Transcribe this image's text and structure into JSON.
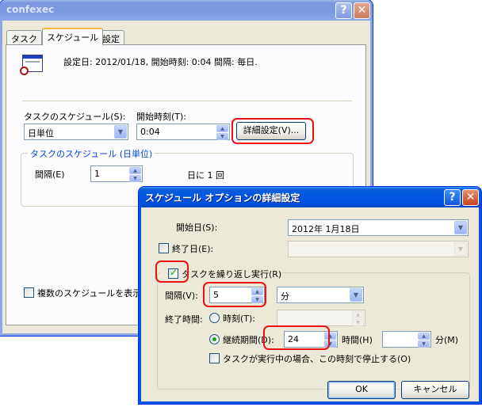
{
  "main_window": {
    "title": "confexec",
    "help_btn": "?",
    "close_btn": "✕",
    "tabs": [
      {
        "label": "タスク"
      },
      {
        "label": "スケジュール"
      },
      {
        "label": "設定"
      }
    ],
    "summary": "設定日: 2012/01/18, 開始時刻: 0:04  間隔: 毎日.",
    "schedule_label": "タスクのスケジュール(S):",
    "schedule_value": "日単位",
    "start_time_label": "開始時刻(T):",
    "start_time_value": "0:04",
    "advanced_button": "詳細設定(V)...",
    "group_daily": "タスクのスケジュール (日単位)",
    "interval_label": "間隔(E)",
    "interval_value": "1",
    "interval_unit": "日に 1 回",
    "multiple_schedules": "複数のスケジュールを表示す"
  },
  "dialog": {
    "title": "スケジュール オプションの詳細設定",
    "help_btn": "?",
    "close_btn": "✕",
    "start_date_label": "開始日(S):",
    "start_date_value": "2012年  1月18日",
    "end_date_label": "終了日(E):",
    "end_date_value": "",
    "repeat_label": "タスクを繰り返し実行(R)",
    "repeat_checked": true,
    "every_label": "間隔(V):",
    "every_value": "5",
    "every_unit": "分",
    "until_label": "終了時間:",
    "time_option": "時刻(T):",
    "duration_option": "継続期間(D):",
    "duration_hours": "24",
    "hours_label": "時間(H)",
    "duration_minutes": "",
    "minutes_label": "分(M)",
    "stop_label": "タスクが実行中の場合、この時刻で停止する(O)",
    "ok_button": "OK",
    "cancel_button": "キャンセル"
  },
  "colors": {
    "highlight": "#ee1111",
    "title_active": "#0055e5",
    "title_inactive": "#7b99e1"
  }
}
